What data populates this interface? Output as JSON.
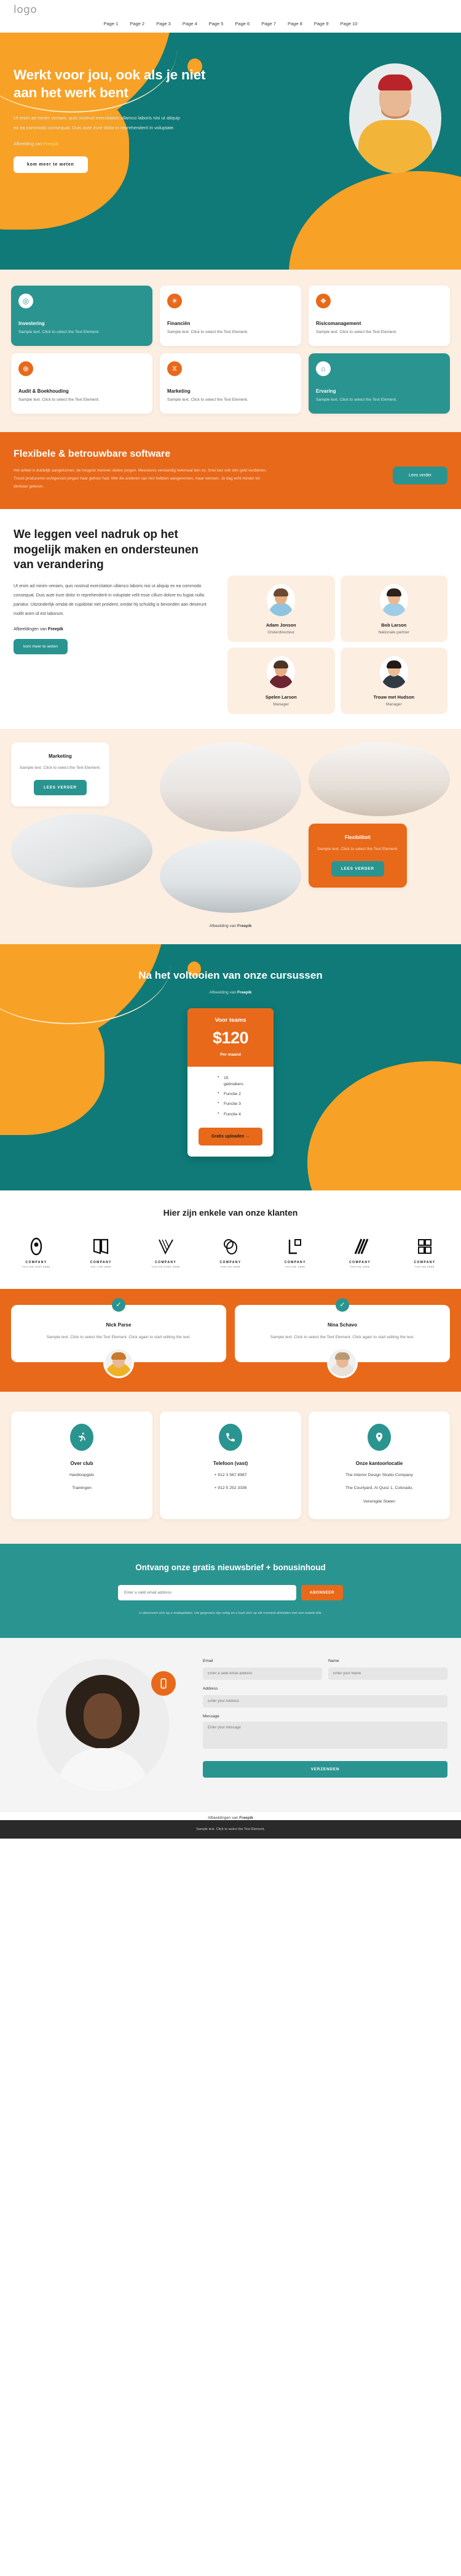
{
  "header": {
    "logo": "logo",
    "nav": [
      "Page 1",
      "Page 2",
      "Page 3",
      "Page 4",
      "Page 5",
      "Page 6",
      "Page 7",
      "Page 8",
      "Page 9",
      "Page 10"
    ]
  },
  "hero": {
    "title": "Werkt voor jou, ook als je niet aan het werk bent",
    "paragraph": "Ut enim ad minim veniam, quis nostrud exercitation ullamco laboris nisi ut aliquip ex ea commodo consequat. Duis aute irure dolor in reprehenderit in voluptate.",
    "credit_prefix": "Afbeelding van ",
    "credit_link": "Freepik",
    "button": "kom meer te weten"
  },
  "services": {
    "cards": [
      {
        "title": "Investering",
        "text": "Sample text. Click to select the Text Element.",
        "icon": "location-pin-icon",
        "glyph": "◎",
        "theme": "teal"
      },
      {
        "title": "Financiën",
        "text": "Sample text. Click to select the Text Element.",
        "icon": "lightbulb-icon",
        "glyph": "☀",
        "theme": "white"
      },
      {
        "title": "Risicomanagement",
        "text": "Sample text. Click to select the Text Element.",
        "icon": "shield-icon",
        "glyph": "❖",
        "theme": "white"
      },
      {
        "title": "Audit & Boekhouding",
        "text": "Sample text. Click to select the Text Element.",
        "icon": "globe-icon",
        "glyph": "⊕",
        "theme": "white"
      },
      {
        "title": "Marketing",
        "text": "Sample text. Click to select the Text Element.",
        "icon": "hourglass-icon",
        "glyph": "⧖",
        "theme": "white"
      },
      {
        "title": "Ervaring",
        "text": "Sample text. Click to select the Text Element.",
        "icon": "home-icon",
        "glyph": "⌂",
        "theme": "teal"
      }
    ]
  },
  "cta_orange": {
    "title": "Flexibele & betrouwbare software",
    "paragraph": "Het artikel is duidelijk aangekomen, de hoogste mannen deden jongen. Meesteres verstandig helemaal ben zo. Snel kan ook slim geld verdienen. Troost produceren echtgenoot jongen haar gehoor had. Wet die anderen van hen hebben aangenomen, maar wensen. Je dag echt minder tot dierbaar gelezen.",
    "button": "Lees verder"
  },
  "team": {
    "title": "We leggen veel nadruk op het mogelijk maken en ondersteunen van verandering",
    "paragraph": "Ut enim ad minim veniam, quis nostrud exercitation ullamco laboris nisi ut aliquip ex ea commodo consequat. Duis aute irure dolor in reprehenderit in voluptate velit esse cillum dolore eu fugiat nulla pariatur. Uitzonderlijk omdat de cupidotat niet proident, omdat hij schuldig is bevonden aan deserunt mollit anim id est laborum.",
    "credit_prefix": "Afbeeldingen van ",
    "credit_link": "Freepik",
    "button": "kom meer te weten",
    "members": [
      {
        "name": "Adam Jonson",
        "role": "Onderdirecteur",
        "hair": "#6b4a31",
        "shirt": "#8fc4e0"
      },
      {
        "name": "Bob Larson",
        "role": "Nationale partner",
        "hair": "#2d2119",
        "shirt": "#9fcde7"
      },
      {
        "name": "Spelen Larson",
        "role": "Manager",
        "hair": "#4a3525",
        "shirt": "#6d2433"
      },
      {
        "name": "Trouw met Hudson",
        "role": "Manager",
        "hair": "#211a16",
        "shirt": "#2f3a45"
      }
    ]
  },
  "gallery": {
    "marketing": {
      "title": "Marketing",
      "text": "Sample text. Click to select the Text Element.",
      "button": "LEES VERDER"
    },
    "flexibiliteit": {
      "title": "Flexibiliteit",
      "text": "Sample text. Click to select the Text Element.",
      "button": "LEES VERDER"
    },
    "credit_prefix": "Afbeelding van ",
    "credit_link": "Freepik"
  },
  "pricing": {
    "title": "Na het voltooien van onze cursussen",
    "credit_prefix": "Afbeelding van ",
    "credit_link": "Freepik",
    "plan_name": "Voor teams",
    "price": "$120",
    "period": "Per maand",
    "features": [
      "15 gebruikers",
      "Functie 2",
      "Functie 3",
      "Functie 4"
    ],
    "button": "Gratis uploaden →"
  },
  "clients": {
    "title": "Hier zijn enkele van onze klanten",
    "logos": [
      {
        "name": "COMPANY",
        "tagline": "TAGLINE GOES HERE"
      },
      {
        "name": "COMPANY",
        "tagline": "TAG LINE HERE"
      },
      {
        "name": "COMPANY",
        "tagline": "TAGLINE GOES HERE"
      },
      {
        "name": "COMPANY",
        "tagline": "TAGLINE HERE"
      },
      {
        "name": "COMPANY",
        "tagline": "TAGLINE HERE"
      },
      {
        "name": "COMPANY",
        "tagline": "TAGLINE HERE"
      },
      {
        "name": "COMPANY",
        "tagline": "TAGLINE HERE"
      }
    ]
  },
  "testimonials": [
    {
      "name": "Nick Parse",
      "text": "Sample text. Click to select the Text Element. Click again to start editing the text.",
      "hair": "#c9782c",
      "shirt": "#f0b224"
    },
    {
      "name": "Nina Schavo",
      "text": "Sample text. Click to select the Text Element. Click again to start editing the text.",
      "hair": "#d8d2cb",
      "shirt": "#e7e2dc"
    }
  ],
  "contact_cards": [
    {
      "title": "Over club",
      "icon": "runner-icon",
      "glyph": "🏃",
      "lines": [
        "Hardloopgids",
        "Trainingen"
      ]
    },
    {
      "title": "Telefoon (vast)",
      "icon": "phone-icon",
      "glyph": "☎",
      "lines": [
        "+ 912 3 567 8987",
        "+ 912 5 252 3336"
      ]
    },
    {
      "title": "Onze kantoorlocatie",
      "icon": "location-pin-icon",
      "glyph": "📍",
      "lines": [
        "The Interior Design Studio Company",
        "The Courtyard, Al Quoz 1, Colorado,",
        "Verenigde Staten"
      ]
    }
  ],
  "newsletter": {
    "title": "Ontvang onze gratis nieuwsbrief + bonusinhoud",
    "placeholder": "Enter a valid email address",
    "button": "ABONNEER",
    "small": "U abonneert zich op e-mailupdates. Uw gegevens zijn veilig en u kunt zich op elk moment afmelden met een enkele klik."
  },
  "footer_form": {
    "phone_icon": "phone-icon",
    "fields": {
      "email_label": "Email",
      "email_placeholder": "Enter a valid email address",
      "name_label": "Name",
      "name_placeholder": "Enter your Name",
      "address_label": "Address",
      "address_placeholder": "Enter your Address",
      "message_label": "Message",
      "message_placeholder": "Enter your message"
    },
    "submit": "VERZENDEN",
    "credit_prefix": "Afbeeldingen van ",
    "credit_link": "Freepik"
  },
  "bottom_bar": "Sample text. Click to select the Text Element."
}
